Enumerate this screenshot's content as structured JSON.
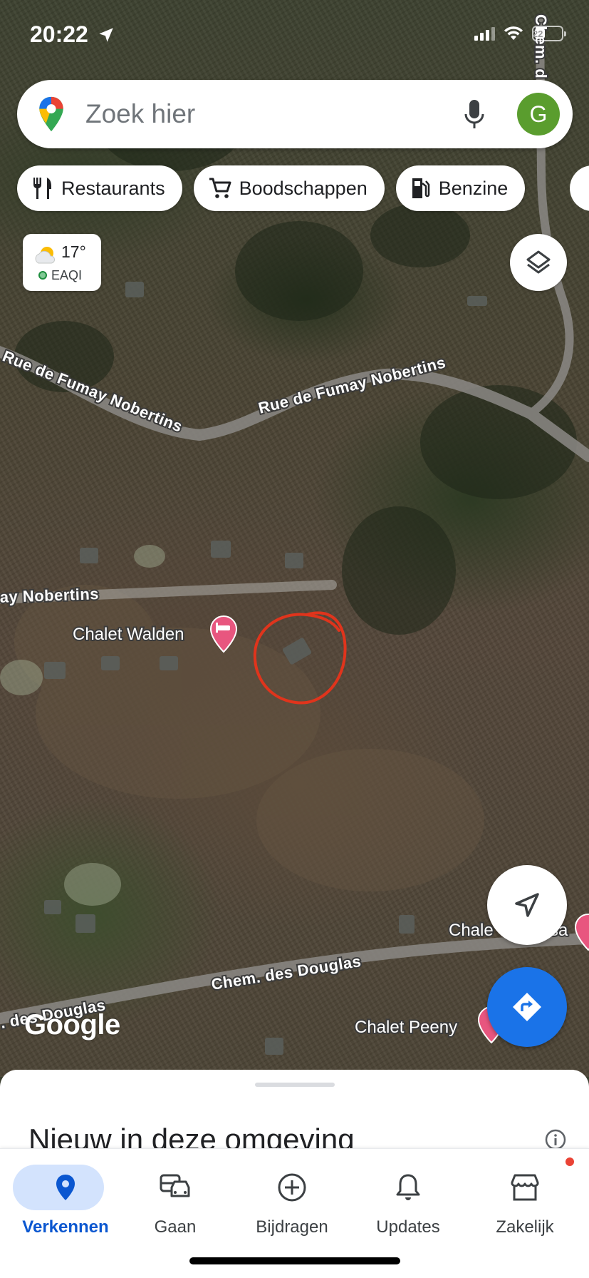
{
  "status_bar": {
    "time": "20:22",
    "battery": "22"
  },
  "search": {
    "placeholder": "Zoek hier",
    "avatar_letter": "G"
  },
  "chips": [
    {
      "label": "Restaurants",
      "icon": "fork-knife-icon"
    },
    {
      "label": "Boodschappen",
      "icon": "cart-icon"
    },
    {
      "label": "Benzine",
      "icon": "fuel-icon"
    }
  ],
  "weather": {
    "temp": "17°",
    "aqi": "EAQI"
  },
  "map": {
    "roads": [
      "Rue de Fumay Nobertins",
      "Rue de Fumay Nobertins",
      "ay Nobertins",
      "Chem. des Douglas",
      ". des Douglas",
      "Chem. d"
    ],
    "pois": [
      {
        "name": "Chalet Walden",
        "type": "hotel"
      },
      {
        "name": "Chalet Peeny",
        "type": "hotel"
      },
      {
        "name": "Chale",
        "type": "hotel"
      },
      {
        "name": "sa",
        "type": "hotel"
      }
    ],
    "attribution": "Google",
    "annotation": "red-circle-marking"
  },
  "sheet": {
    "title": "Nieuw in deze omgeving"
  },
  "nav": [
    {
      "label": "Verkennen",
      "icon": "pin-icon",
      "active": true
    },
    {
      "label": "Gaan",
      "icon": "car-icon",
      "active": false
    },
    {
      "label": "Bijdragen",
      "icon": "add-circle-icon",
      "active": false
    },
    {
      "label": "Updates",
      "icon": "bell-icon",
      "active": false
    },
    {
      "label": "Zakelijk",
      "icon": "store-icon",
      "active": false
    }
  ],
  "colors": {
    "accent": "#1a73e8",
    "poi_pink": "#e8567f",
    "annotation_red": "#e0341c",
    "active_pill": "#d3e3fd"
  }
}
